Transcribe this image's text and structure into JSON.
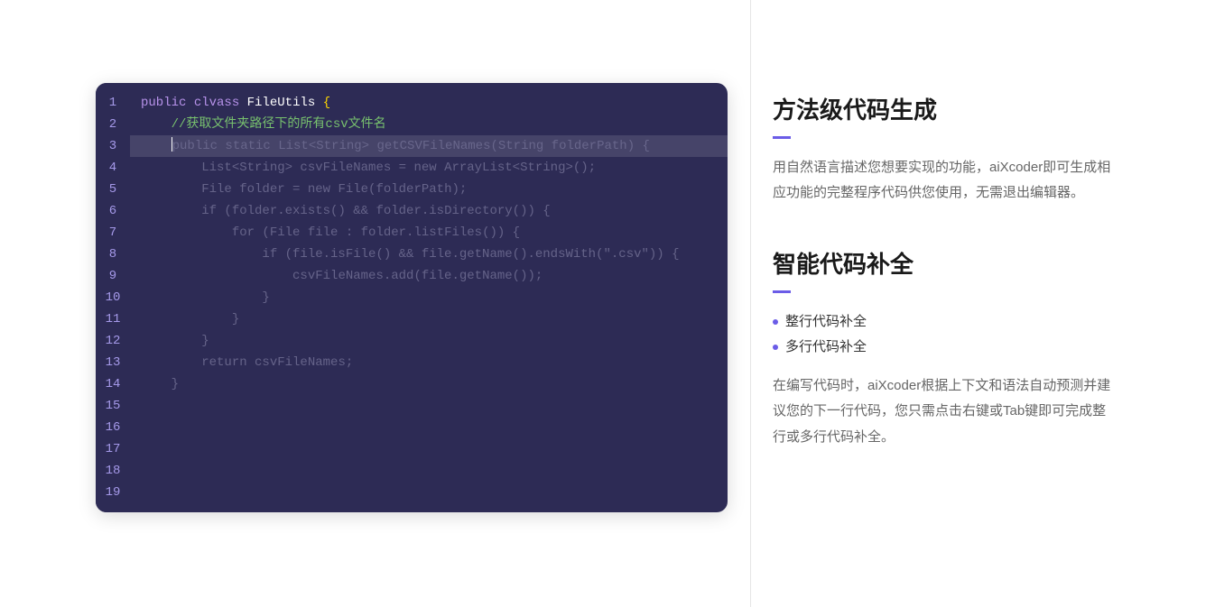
{
  "editor": {
    "line_numbers": [
      "1",
      "2",
      "3",
      "4",
      "5",
      "6",
      "7",
      "8",
      "9",
      "10",
      "11",
      "12",
      "13",
      "14",
      "15",
      "16",
      "17",
      "18",
      "19"
    ],
    "lines": {
      "l1": {
        "kw1": "public",
        "kw2": "clvass",
        "cls": "FileUtils",
        "brace": "{"
      },
      "l2": {
        "indent": "    ",
        "cmt": "//获取文件夹路径下的所有csv文件名"
      },
      "l3": {
        "indent": "    ",
        "ghost": "public static List<String> getCSVFileNames(String folderPath) {"
      },
      "l4": {
        "indent": "        ",
        "ghost": "List<String> csvFileNames = new ArrayList<String>();"
      },
      "l5": {
        "indent": "        ",
        "ghost": "File folder = new File(folderPath);"
      },
      "l6": {
        "indent": "        ",
        "ghost": "if (folder.exists() && folder.isDirectory()) {"
      },
      "l7": {
        "indent": "            ",
        "ghost": "for (File file : folder.listFiles()) {"
      },
      "l8": {
        "indent": "                ",
        "ghost": "if (file.isFile() && file.getName().endsWith(\".csv\")) {"
      },
      "l9": {
        "indent": "                    ",
        "ghost": "csvFileNames.add(file.getName());"
      },
      "l10": {
        "indent": "                ",
        "ghost": "}"
      },
      "l11": {
        "indent": "            ",
        "ghost": "}"
      },
      "l12": {
        "indent": "        ",
        "ghost": "}"
      },
      "l13": {
        "indent": "        ",
        "ghost": "return csvFileNames;"
      },
      "l14": {
        "indent": "    ",
        "ghost": "}"
      }
    }
  },
  "features": {
    "section1": {
      "title": "方法级代码生成",
      "desc": "用自然语言描述您想要实现的功能，aiXcoder即可生成相应功能的完整程序代码供您使用，无需退出编辑器。"
    },
    "section2": {
      "title": "智能代码补全",
      "bullets": [
        "整行代码补全",
        "多行代码补全"
      ],
      "desc": "在编写代码时，aiXcoder根据上下文和语法自动预测并建议您的下一行代码，您只需点击右键或Tab键即可完成整行或多行代码补全。"
    }
  }
}
